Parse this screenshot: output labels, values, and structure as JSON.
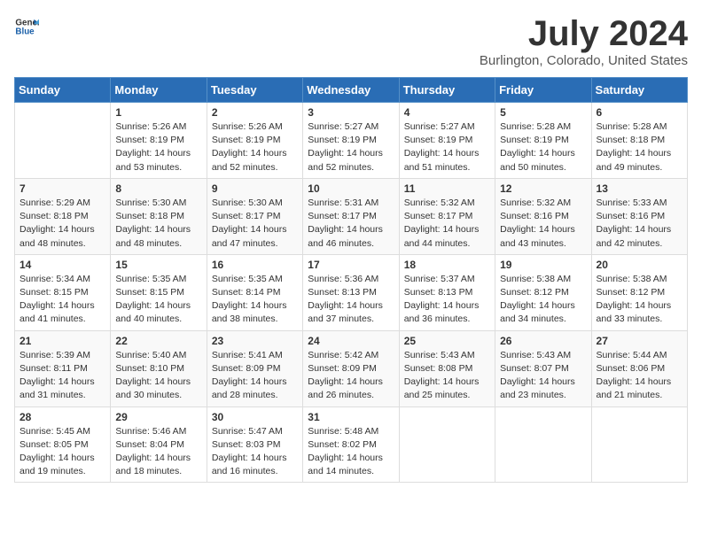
{
  "logo": {
    "text_general": "General",
    "text_blue": "Blue"
  },
  "title": "July 2024",
  "subtitle": "Burlington, Colorado, United States",
  "days_of_week": [
    "Sunday",
    "Monday",
    "Tuesday",
    "Wednesday",
    "Thursday",
    "Friday",
    "Saturday"
  ],
  "weeks": [
    [
      {
        "day": "",
        "info": ""
      },
      {
        "day": "1",
        "info": "Sunrise: 5:26 AM\nSunset: 8:19 PM\nDaylight: 14 hours\nand 53 minutes."
      },
      {
        "day": "2",
        "info": "Sunrise: 5:26 AM\nSunset: 8:19 PM\nDaylight: 14 hours\nand 52 minutes."
      },
      {
        "day": "3",
        "info": "Sunrise: 5:27 AM\nSunset: 8:19 PM\nDaylight: 14 hours\nand 52 minutes."
      },
      {
        "day": "4",
        "info": "Sunrise: 5:27 AM\nSunset: 8:19 PM\nDaylight: 14 hours\nand 51 minutes."
      },
      {
        "day": "5",
        "info": "Sunrise: 5:28 AM\nSunset: 8:19 PM\nDaylight: 14 hours\nand 50 minutes."
      },
      {
        "day": "6",
        "info": "Sunrise: 5:28 AM\nSunset: 8:18 PM\nDaylight: 14 hours\nand 49 minutes."
      }
    ],
    [
      {
        "day": "7",
        "info": "Sunrise: 5:29 AM\nSunset: 8:18 PM\nDaylight: 14 hours\nand 48 minutes."
      },
      {
        "day": "8",
        "info": "Sunrise: 5:30 AM\nSunset: 8:18 PM\nDaylight: 14 hours\nand 48 minutes."
      },
      {
        "day": "9",
        "info": "Sunrise: 5:30 AM\nSunset: 8:17 PM\nDaylight: 14 hours\nand 47 minutes."
      },
      {
        "day": "10",
        "info": "Sunrise: 5:31 AM\nSunset: 8:17 PM\nDaylight: 14 hours\nand 46 minutes."
      },
      {
        "day": "11",
        "info": "Sunrise: 5:32 AM\nSunset: 8:17 PM\nDaylight: 14 hours\nand 44 minutes."
      },
      {
        "day": "12",
        "info": "Sunrise: 5:32 AM\nSunset: 8:16 PM\nDaylight: 14 hours\nand 43 minutes."
      },
      {
        "day": "13",
        "info": "Sunrise: 5:33 AM\nSunset: 8:16 PM\nDaylight: 14 hours\nand 42 minutes."
      }
    ],
    [
      {
        "day": "14",
        "info": "Sunrise: 5:34 AM\nSunset: 8:15 PM\nDaylight: 14 hours\nand 41 minutes."
      },
      {
        "day": "15",
        "info": "Sunrise: 5:35 AM\nSunset: 8:15 PM\nDaylight: 14 hours\nand 40 minutes."
      },
      {
        "day": "16",
        "info": "Sunrise: 5:35 AM\nSunset: 8:14 PM\nDaylight: 14 hours\nand 38 minutes."
      },
      {
        "day": "17",
        "info": "Sunrise: 5:36 AM\nSunset: 8:13 PM\nDaylight: 14 hours\nand 37 minutes."
      },
      {
        "day": "18",
        "info": "Sunrise: 5:37 AM\nSunset: 8:13 PM\nDaylight: 14 hours\nand 36 minutes."
      },
      {
        "day": "19",
        "info": "Sunrise: 5:38 AM\nSunset: 8:12 PM\nDaylight: 14 hours\nand 34 minutes."
      },
      {
        "day": "20",
        "info": "Sunrise: 5:38 AM\nSunset: 8:12 PM\nDaylight: 14 hours\nand 33 minutes."
      }
    ],
    [
      {
        "day": "21",
        "info": "Sunrise: 5:39 AM\nSunset: 8:11 PM\nDaylight: 14 hours\nand 31 minutes."
      },
      {
        "day": "22",
        "info": "Sunrise: 5:40 AM\nSunset: 8:10 PM\nDaylight: 14 hours\nand 30 minutes."
      },
      {
        "day": "23",
        "info": "Sunrise: 5:41 AM\nSunset: 8:09 PM\nDaylight: 14 hours\nand 28 minutes."
      },
      {
        "day": "24",
        "info": "Sunrise: 5:42 AM\nSunset: 8:09 PM\nDaylight: 14 hours\nand 26 minutes."
      },
      {
        "day": "25",
        "info": "Sunrise: 5:43 AM\nSunset: 8:08 PM\nDaylight: 14 hours\nand 25 minutes."
      },
      {
        "day": "26",
        "info": "Sunrise: 5:43 AM\nSunset: 8:07 PM\nDaylight: 14 hours\nand 23 minutes."
      },
      {
        "day": "27",
        "info": "Sunrise: 5:44 AM\nSunset: 8:06 PM\nDaylight: 14 hours\nand 21 minutes."
      }
    ],
    [
      {
        "day": "28",
        "info": "Sunrise: 5:45 AM\nSunset: 8:05 PM\nDaylight: 14 hours\nand 19 minutes."
      },
      {
        "day": "29",
        "info": "Sunrise: 5:46 AM\nSunset: 8:04 PM\nDaylight: 14 hours\nand 18 minutes."
      },
      {
        "day": "30",
        "info": "Sunrise: 5:47 AM\nSunset: 8:03 PM\nDaylight: 14 hours\nand 16 minutes."
      },
      {
        "day": "31",
        "info": "Sunrise: 5:48 AM\nSunset: 8:02 PM\nDaylight: 14 hours\nand 14 minutes."
      },
      {
        "day": "",
        "info": ""
      },
      {
        "day": "",
        "info": ""
      },
      {
        "day": "",
        "info": ""
      }
    ]
  ]
}
